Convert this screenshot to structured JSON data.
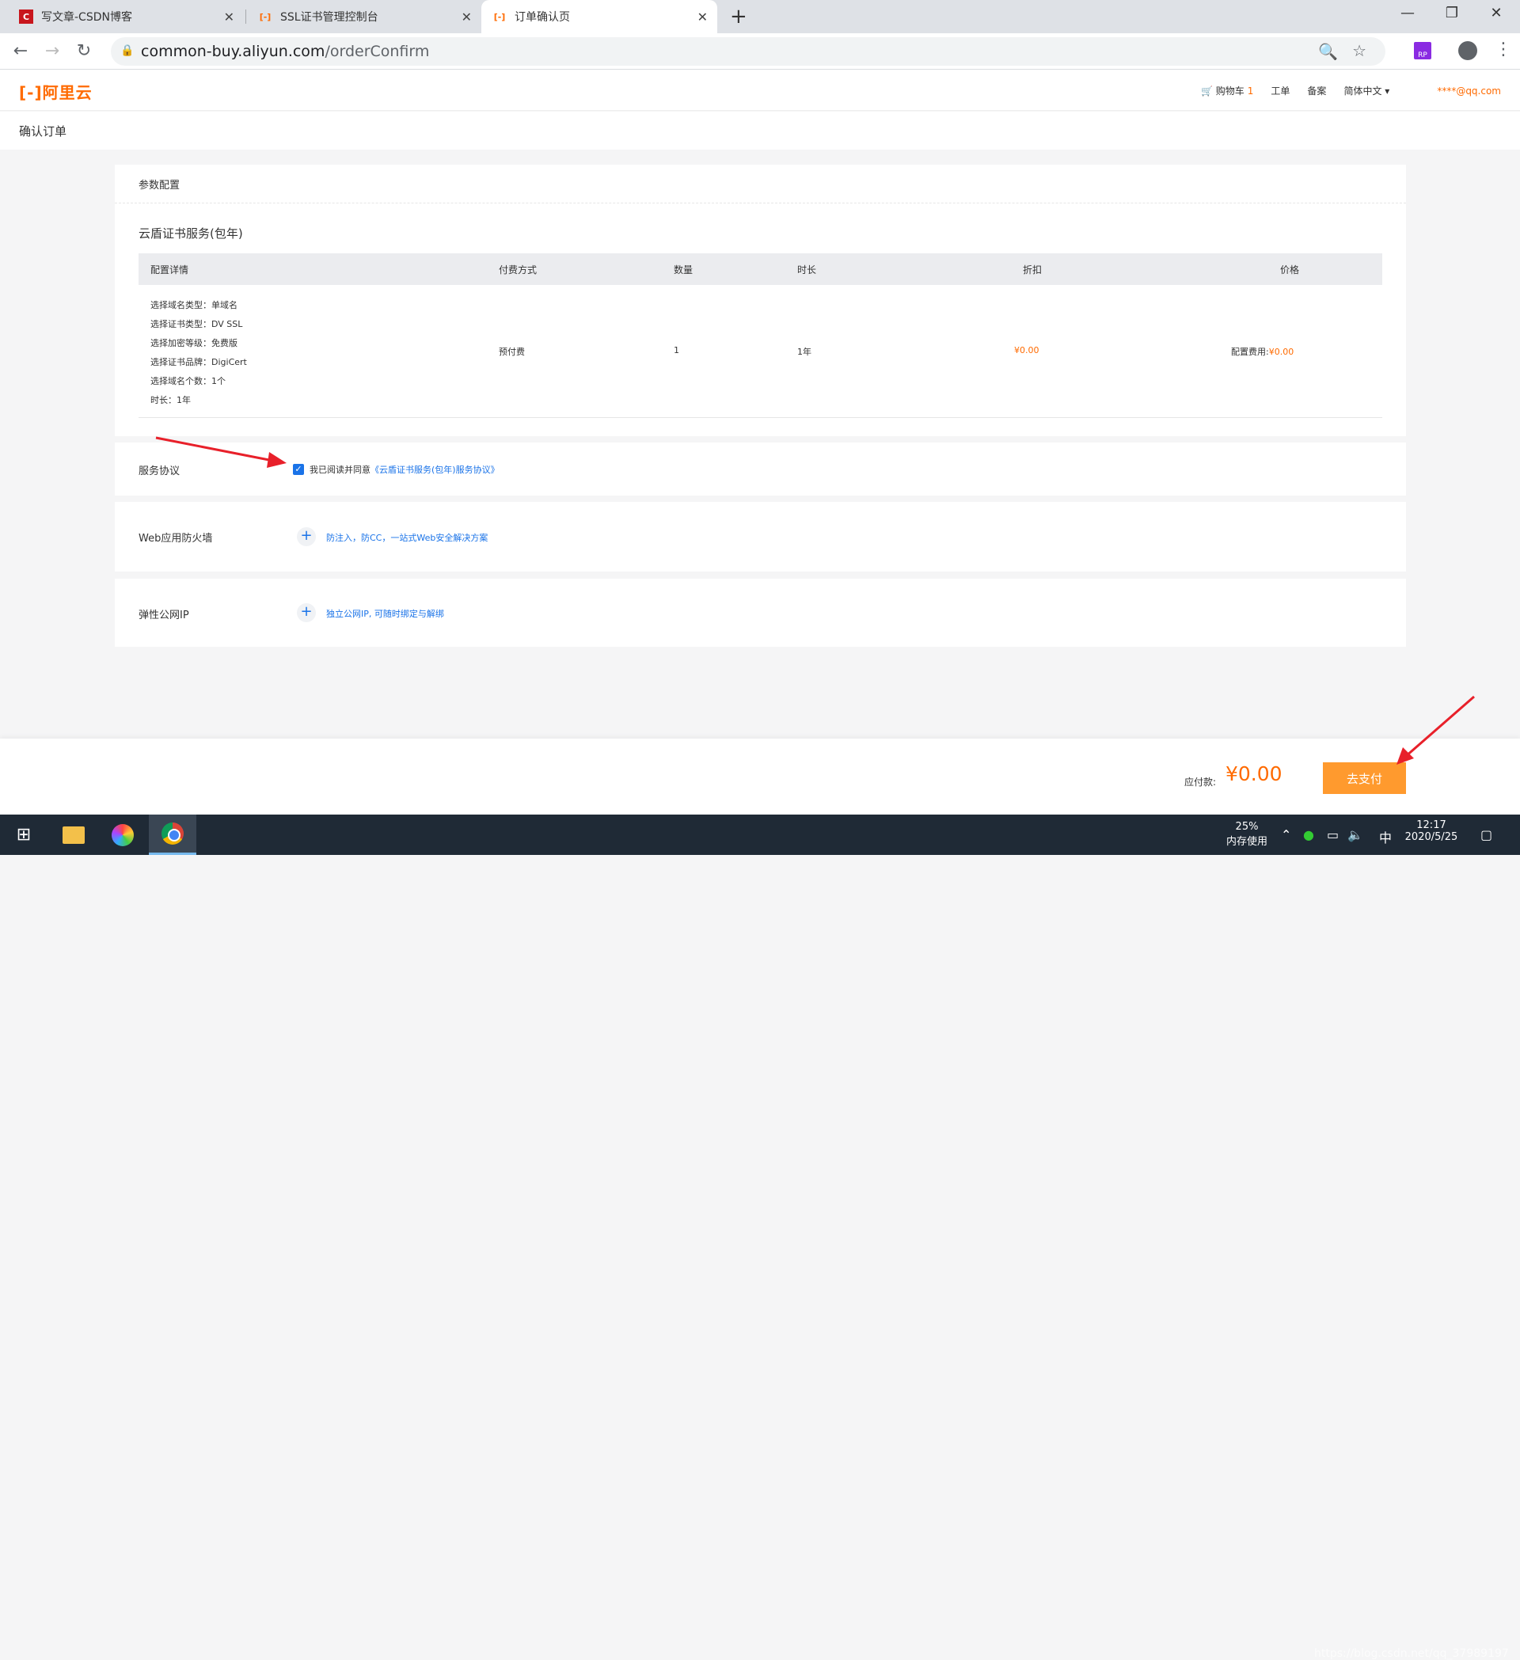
{
  "browser": {
    "tabs": [
      {
        "label": "写文章-CSDN博客",
        "icon": "csdn-icon"
      },
      {
        "label": "SSL证书管理控制台",
        "icon": "aliyun-icon"
      },
      {
        "label": "订单确认页",
        "icon": "aliyun-icon",
        "active": true
      }
    ],
    "url_host": "common-buy.aliyun.com",
    "url_path": "/orderConfirm",
    "ext_label": "RP"
  },
  "header": {
    "logo_text": "[-]阿里云",
    "cart_label": "购物车",
    "cart_count": "1",
    "ticket_label": "工单",
    "filing_label": "备案",
    "language_label": "简体中文",
    "user_email": "****@qq.com"
  },
  "page": {
    "title": "确认订单"
  },
  "config": {
    "section_title": "参数配置",
    "product_title": "云盾证书服务(包年)",
    "columns": [
      "配置详情",
      "付费方式",
      "数量",
      "时长",
      "折扣",
      "价格"
    ],
    "details": [
      "选择域名类型：单域名",
      "选择证书类型：DV SSL",
      "选择加密等级：免费版",
      "选择证书品牌：DigiCert",
      "选择域名个数：1个",
      "时长：1年"
    ],
    "payment_method": "预付费",
    "quantity": "1",
    "duration": "1年",
    "discount": "¥0.00",
    "price_label": "配置费用:",
    "price_value": "¥0.00"
  },
  "agreement": {
    "label": "服务协议",
    "check_mark": "✓",
    "text": "我已阅读并同意",
    "link": "《云盾证书服务(包年)服务协议》"
  },
  "waf": {
    "label": "Web应用防火墙",
    "link": "防注入，防CC，一站式Web安全解决方案"
  },
  "eip": {
    "label": "弹性公网IP",
    "link": "独立公网IP, 可随时绑定与解绑"
  },
  "paybar": {
    "amount_label": "应付款:",
    "amount": "¥0.00",
    "pay_button": "去支付"
  },
  "taskbar": {
    "memory_percent": "25%",
    "memory_label": "内存使用",
    "time": "12:17",
    "date": "2020/5/25",
    "ime_label": "中",
    "watermark": "https://blog.csdn.net/qq_37989197"
  },
  "colors": {
    "accent": "#ff6a00",
    "link": "#1a73e8",
    "pay_button": "#ff9a2e",
    "annotation_arrow": "#e8202a"
  }
}
